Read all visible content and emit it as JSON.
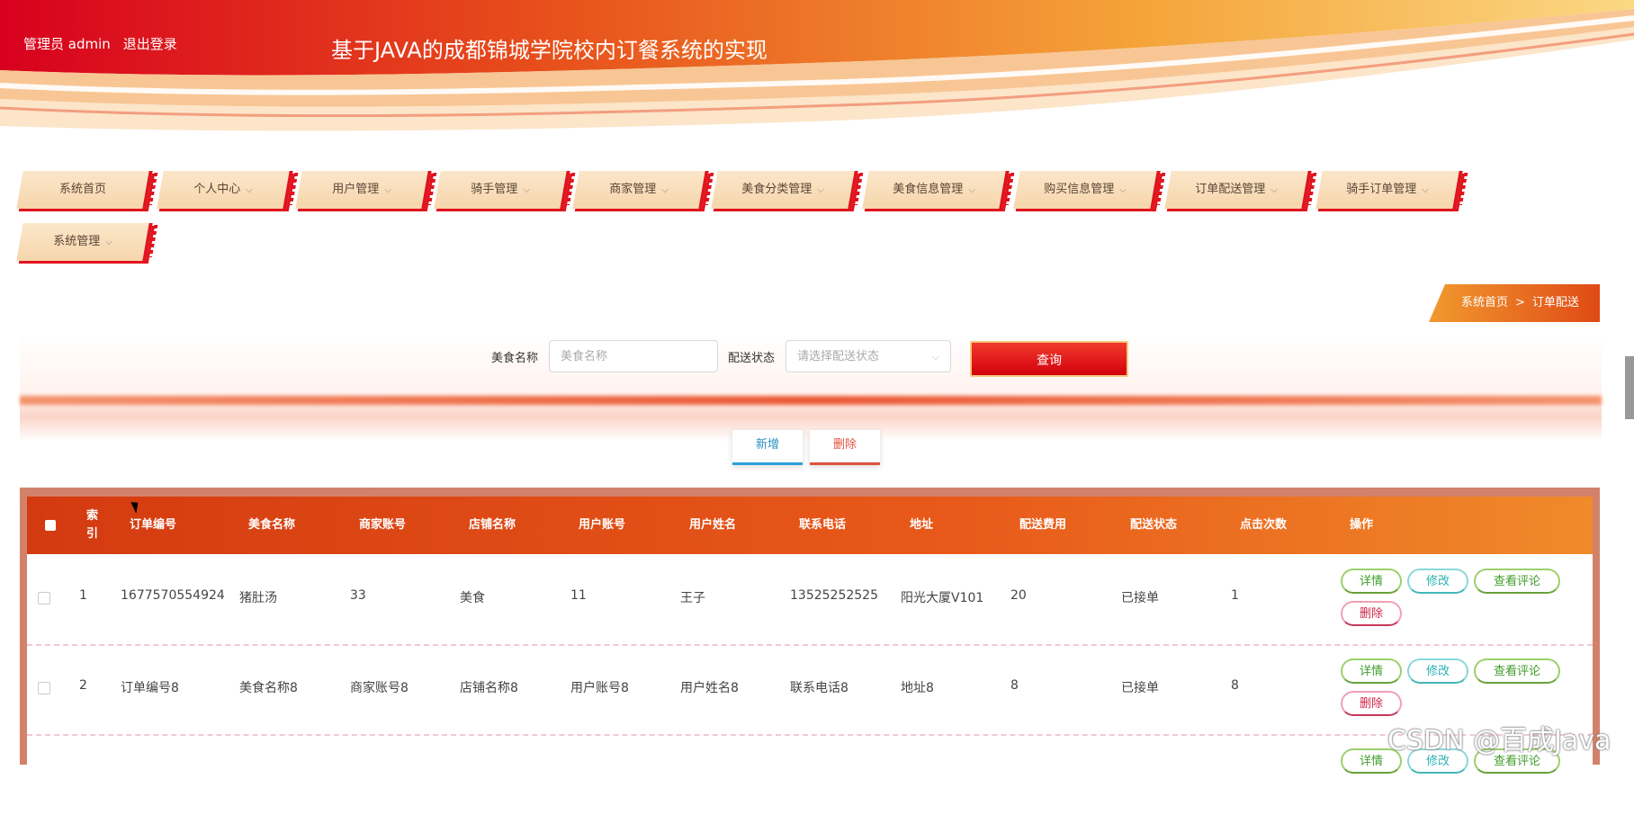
{
  "header": {
    "user_label": "管理员 admin",
    "logout_label": "退出登录",
    "title": "基于JAVA的成都锦城学院校内订餐系统的实现"
  },
  "nav": [
    {
      "label": "系统首页",
      "has_dropdown": false
    },
    {
      "label": "个人中心",
      "has_dropdown": true
    },
    {
      "label": "用户管理",
      "has_dropdown": true
    },
    {
      "label": "骑手管理",
      "has_dropdown": true
    },
    {
      "label": "商家管理",
      "has_dropdown": true
    },
    {
      "label": "美食分类管理",
      "has_dropdown": true
    },
    {
      "label": "美食信息管理",
      "has_dropdown": true
    },
    {
      "label": "购买信息管理",
      "has_dropdown": true
    },
    {
      "label": "订单配送管理",
      "has_dropdown": true
    },
    {
      "label": "骑手订单管理",
      "has_dropdown": true
    },
    {
      "label": "系统管理",
      "has_dropdown": true
    }
  ],
  "breadcrumb": {
    "home": "系统首页",
    "separator": ">",
    "current": "订单配送"
  },
  "search": {
    "food_label": "美食名称",
    "food_placeholder": "美食名称",
    "status_label": "配送状态",
    "status_placeholder": "请选择配送状态",
    "query_label": "查询"
  },
  "actions": {
    "add_label": "新增",
    "delete_label": "删除"
  },
  "table": {
    "headers": [
      "索引",
      "订单编号",
      "美食名称",
      "商家账号",
      "店铺名称",
      "用户账号",
      "用户姓名",
      "联系电话",
      "地址",
      "配送费用",
      "配送状态",
      "点击次数",
      "操作"
    ],
    "index_header_top": "索",
    "index_header_bottom": "引",
    "rows": [
      [
        "1",
        "1677570554924",
        "猪肚汤",
        "33",
        "美食",
        "11",
        "王子",
        "13525252525",
        "阳光大厦V101",
        "20",
        "已接单",
        "1"
      ],
      [
        "2",
        "订单编号8",
        "美食名称8",
        "商家账号8",
        "店铺名称8",
        "用户账号8",
        "用户姓名8",
        "联系电话8",
        "地址8",
        "8",
        "已接单",
        "8"
      ]
    ],
    "ops": {
      "detail": "详情",
      "edit": "修改",
      "review": "查看评论",
      "remove": "删除"
    }
  },
  "watermark": "CSDN @百成Java",
  "colors": {
    "primary_red": "#d3000e",
    "accent_orange": "#f08a2a",
    "nav_tab": "#f6d6ac"
  }
}
